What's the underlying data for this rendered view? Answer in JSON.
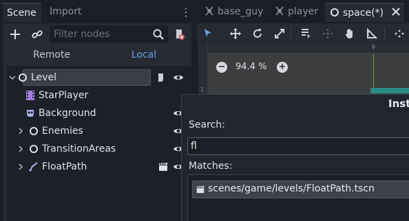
{
  "scene_dock": {
    "tabs": [
      {
        "label": "Scene"
      },
      {
        "label": "Import"
      }
    ],
    "filter_placeholder": "Filter nodes",
    "remote_label": "Remote",
    "local_label": "Local",
    "tree": [
      {
        "label": "Level",
        "icon": "node-circle-icon",
        "expandable": true,
        "expanded": true,
        "selected": true,
        "extra": "script-icon",
        "visible_eye": true
      },
      {
        "label": "StarPlayer",
        "icon": "film-strip-icon",
        "expandable": false,
        "visible_eye": false
      },
      {
        "label": "Background",
        "icon": "skull-sprite-icon",
        "expandable": false,
        "visible_eye": true
      },
      {
        "label": "Enemies",
        "icon": "node-circle-icon",
        "expandable": true,
        "expanded": false,
        "visible_eye": true
      },
      {
        "label": "TransitionAreas",
        "icon": "node-circle-icon",
        "expandable": true,
        "expanded": false,
        "visible_eye": true
      },
      {
        "label": "FloatPath",
        "icon": "path-curve-icon",
        "expandable": true,
        "expanded": false,
        "extra": "clapperboard-icon",
        "visible_eye": true
      }
    ]
  },
  "editor": {
    "tabs": [
      {
        "label": "base_guy",
        "icon": "scene-tree-icon"
      },
      {
        "label": "player",
        "icon": "scene-tree-icon"
      },
      {
        "label": "space(*)",
        "icon": "node-circle-icon",
        "active": true
      }
    ],
    "zoom": {
      "value": "94.4 %"
    },
    "ruler_zero": "0",
    "ruler_side_mark": "1"
  },
  "dialog": {
    "title": "Inst",
    "search_label": "Search:",
    "search_value": "fl",
    "matches_label": "Matches:",
    "matches": [
      "scenes/game/levels/FloatPath.tscn"
    ]
  },
  "colors": {
    "accent": "#6aa0e8",
    "axis_green": "#6a9c3a",
    "teal": "#2a8a86",
    "panel": "#262a33",
    "background": "#1b1e25"
  }
}
